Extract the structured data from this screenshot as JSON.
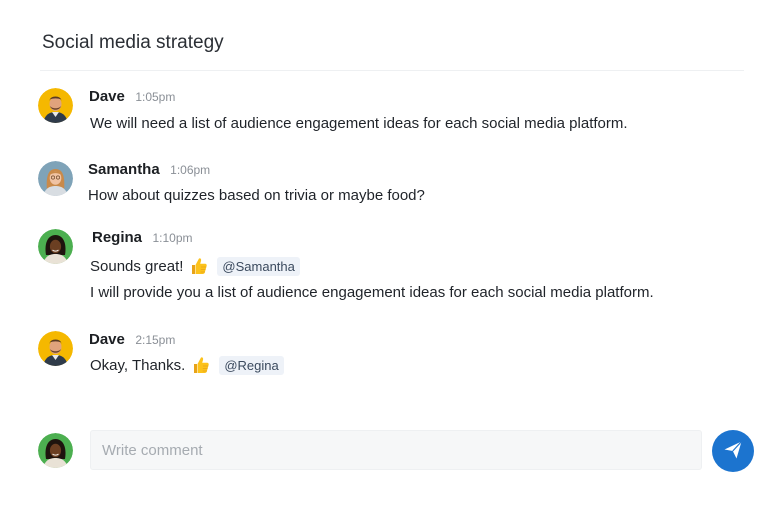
{
  "header": {
    "title": "Social media strategy"
  },
  "messages": [
    {
      "author": "Dave",
      "time": "1:05pm",
      "lines": [
        "We will need a list of audience engagement ideas for each social media platform."
      ]
    },
    {
      "author": "Samantha",
      "time": "1:06pm",
      "lines": [
        "How about quizzes based on trivia or maybe food?"
      ]
    },
    {
      "author": "Regina",
      "time": "1:10pm",
      "lines": [
        "Sounds great!",
        "I will provide you a list of audience engagement ideas for each social media platform."
      ],
      "emoji": "thumbs-up-icon",
      "mention": "@Samantha"
    },
    {
      "author": "Dave",
      "time": "2:15pm",
      "lines": [
        "Okay, Thanks."
      ],
      "emoji": "thumbs-up-icon",
      "mention": "@Regina"
    }
  ],
  "composer": {
    "placeholder": "Write comment",
    "value": "",
    "send_icon": "paper-plane-icon"
  },
  "colors": {
    "accent": "#1c74cf",
    "mention_bg": "#eef2f8",
    "dave_avatar_bg": "#f5b800",
    "samantha_avatar_bg": "#7fa3b8",
    "regina_avatar_bg": "#4caf50"
  }
}
